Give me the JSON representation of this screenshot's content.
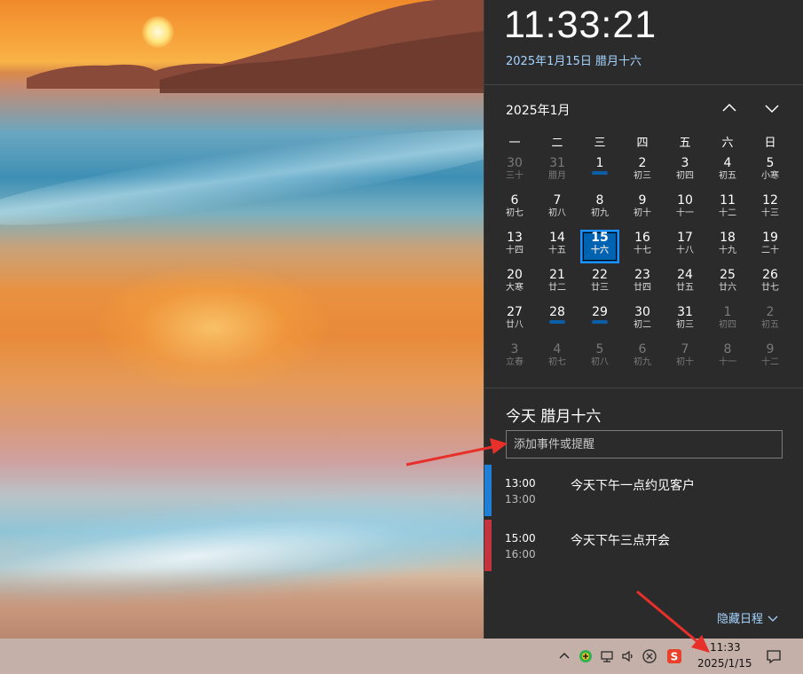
{
  "flyout": {
    "clock": "11:33:21",
    "full_date": "2025年1月15日 腊月十六",
    "month_title": "2025年1月",
    "weekdays": [
      "一",
      "二",
      "三",
      "四",
      "五",
      "六",
      "日"
    ],
    "weeks": [
      [
        {
          "n": "30",
          "l": "三十",
          "o": true
        },
        {
          "n": "31",
          "l": "腊月",
          "o": true
        },
        {
          "n": "1",
          "l": "",
          "ev": true
        },
        {
          "n": "2",
          "l": "初三"
        },
        {
          "n": "3",
          "l": "初四"
        },
        {
          "n": "4",
          "l": "初五"
        },
        {
          "n": "5",
          "l": "小寒"
        }
      ],
      [
        {
          "n": "6",
          "l": "初七"
        },
        {
          "n": "7",
          "l": "初八"
        },
        {
          "n": "8",
          "l": "初九"
        },
        {
          "n": "9",
          "l": "初十"
        },
        {
          "n": "10",
          "l": "十一"
        },
        {
          "n": "11",
          "l": "十二"
        },
        {
          "n": "12",
          "l": "十三"
        }
      ],
      [
        {
          "n": "13",
          "l": "十四"
        },
        {
          "n": "14",
          "l": "十五"
        },
        {
          "n": "15",
          "l": "十六",
          "t": true
        },
        {
          "n": "16",
          "l": "十七"
        },
        {
          "n": "17",
          "l": "十八"
        },
        {
          "n": "18",
          "l": "十九"
        },
        {
          "n": "19",
          "l": "二十"
        }
      ],
      [
        {
          "n": "20",
          "l": "大寒"
        },
        {
          "n": "21",
          "l": "廿二"
        },
        {
          "n": "22",
          "l": "廿三"
        },
        {
          "n": "23",
          "l": "廿四"
        },
        {
          "n": "24",
          "l": "廿五"
        },
        {
          "n": "25",
          "l": "廿六"
        },
        {
          "n": "26",
          "l": "廿七"
        }
      ],
      [
        {
          "n": "27",
          "l": "廿八"
        },
        {
          "n": "28",
          "l": "",
          "ev": true
        },
        {
          "n": "29",
          "l": "",
          "ev": true
        },
        {
          "n": "30",
          "l": "初二"
        },
        {
          "n": "31",
          "l": "初三"
        },
        {
          "n": "1",
          "l": "初四",
          "o": true
        },
        {
          "n": "2",
          "l": "初五",
          "o": true
        }
      ],
      [
        {
          "n": "3",
          "l": "立春",
          "o": true
        },
        {
          "n": "4",
          "l": "初七",
          "o": true
        },
        {
          "n": "5",
          "l": "初八",
          "o": true
        },
        {
          "n": "6",
          "l": "初九",
          "o": true
        },
        {
          "n": "7",
          "l": "初十",
          "o": true
        },
        {
          "n": "8",
          "l": "十一",
          "o": true
        },
        {
          "n": "9",
          "l": "十二",
          "o": true
        }
      ]
    ],
    "agenda_title": "今天 腊月十六",
    "add_event_placeholder": "添加事件或提醒",
    "events": [
      {
        "start": "13:00",
        "end": "13:00",
        "title": "今天下午一点约见客户",
        "color": "#1f7fd6"
      },
      {
        "start": "15:00",
        "end": "16:00",
        "title": "今天下午三点开会",
        "color": "#c3343f"
      }
    ],
    "hide_agenda_label": "隐藏日程"
  },
  "taskbar": {
    "time": "11:33",
    "date": "2025/1/15",
    "tray_icons": [
      "chevron-up-icon",
      "plus-badge-icon",
      "network-icon",
      "volume-icon",
      "close-circle-icon",
      "sogou-ime-icon",
      "notification-icon"
    ]
  },
  "colors": {
    "accent": "#0063b1",
    "highlight": "#a6d4ff",
    "flyout_bg": "#2b2b2b",
    "arrow": "#e8302a"
  }
}
